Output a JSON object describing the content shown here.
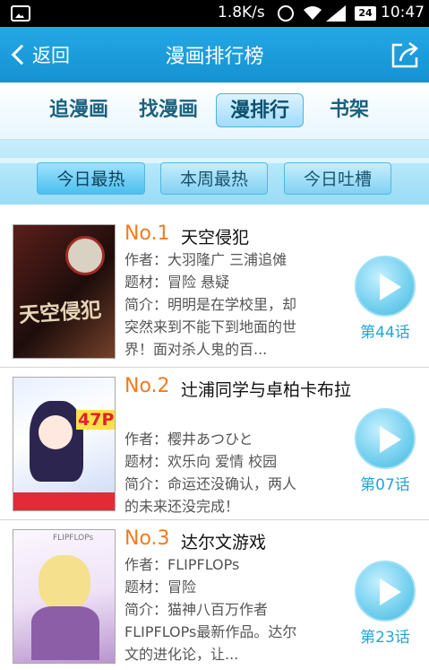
{
  "status_bar": {
    "speed": "1.8K/s",
    "battery": "24",
    "time": "10:47"
  },
  "header": {
    "back_label": "返回",
    "title": "漫画排行榜"
  },
  "main_tabs": [
    {
      "label": "追漫画"
    },
    {
      "label": "找漫画"
    },
    {
      "label": "漫排行",
      "active": true
    },
    {
      "label": "书架"
    }
  ],
  "sub_tabs": [
    {
      "label": "今日最热",
      "active": true
    },
    {
      "label": "本周最热"
    },
    {
      "label": "今日吐槽"
    }
  ],
  "comics": [
    {
      "rank": "No.1",
      "title": "天空侵犯",
      "author": "作者：大羽隆广 三浦追傩",
      "genre": "题材：冒险 悬疑",
      "desc_line1": "简介：明明是在学校里，却",
      "desc_line2": "突然来到不能下到地面的世",
      "desc_line3": "界！面对杀人鬼的百...",
      "episode": "第44话",
      "cover_text": "天空侵犯",
      "cover_color": "#3a1512"
    },
    {
      "rank": "No.2",
      "title": "辻浦同学与卓柏卡布拉",
      "author": "作者：樱井あつひと",
      "genre": "题材：欢乐向 爱情 校园",
      "desc_line1": "简介：命运还没确认，两人",
      "desc_line2": "的未来还没完成！",
      "episode": "第07话",
      "cover_text": "47P!!",
      "cover_color": "#2f6fbf"
    },
    {
      "rank": "No.3",
      "title": "达尔文游戏",
      "author": "作者：FLIPFLOPs",
      "genre": "题材：冒险",
      "desc_line1": "简介：猫神八百万作者",
      "desc_line2": "FLIPFLOPs最新作品。达尔",
      "desc_line3": "文的进化论，让...",
      "episode": "第23话",
      "cover_text": "FLIPFLOPs",
      "cover_color": "#c2a6d8"
    }
  ],
  "colors": {
    "accent": "#1a9ee0",
    "rank": "#f27b1f",
    "episode": "#24a5d7"
  },
  "icons": [
    "gallery-icon",
    "alarm-icon",
    "wifi-icon",
    "signal-icon",
    "back-arrow-icon",
    "share-icon",
    "play-icon"
  ]
}
